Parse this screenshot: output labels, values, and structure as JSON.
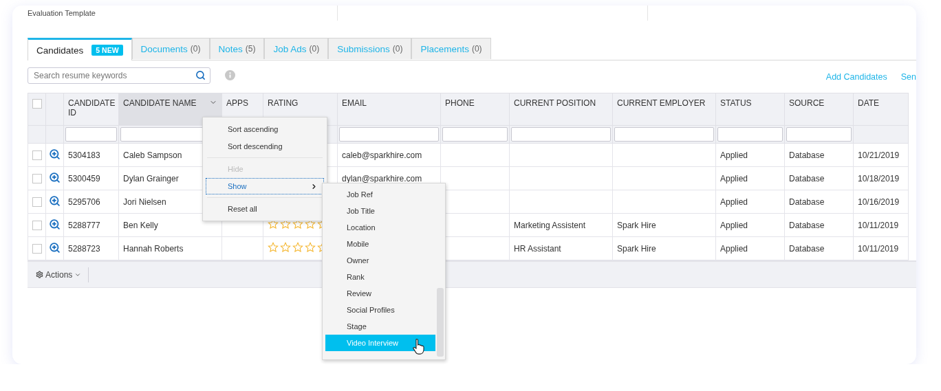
{
  "header_strip": {
    "label": "Evaluation Template"
  },
  "tabs": [
    {
      "label": "Candidates",
      "badge": "5 NEW",
      "selected": true
    },
    {
      "label": "Documents",
      "count": "(0)",
      "selected": false
    },
    {
      "label": "Notes",
      "count": "(5)",
      "selected": false
    },
    {
      "label": "Job Ads",
      "count": "(0)",
      "selected": false
    },
    {
      "label": "Submissions",
      "count": "(0)",
      "selected": false
    },
    {
      "label": "Placements",
      "count": "(0)",
      "selected": false
    }
  ],
  "toolbar": {
    "search": {
      "placeholder": "Search resume keywords"
    },
    "links": [
      "Add Candidates",
      "Sen"
    ]
  },
  "table": {
    "select_all": {
      "checked": false
    },
    "columns": [
      {
        "label": "CANDIDATE ID",
        "filter": true,
        "active": false
      },
      {
        "label": "CANDIDATE NAME",
        "filter": true,
        "active": true
      },
      {
        "label": "APPS",
        "active": false
      },
      {
        "label": "RATING",
        "filter": false,
        "active": false
      },
      {
        "label": "EMAIL",
        "filter": true,
        "active": false
      },
      {
        "label": "PHONE",
        "filter": true,
        "active": false
      },
      {
        "label": "CURRENT POSITION",
        "filter": true,
        "active": false
      },
      {
        "label": "CURRENT EMPLOYER",
        "filter": true,
        "active": false
      },
      {
        "label": "STATUS",
        "filter": true,
        "active": false
      },
      {
        "label": "SOURCE",
        "filter": true,
        "active": false
      },
      {
        "label": "DATE",
        "filter": false,
        "active": false
      }
    ],
    "rows": [
      {
        "checked": false,
        "id": "5304183",
        "name": "Caleb Sampson",
        "email": "caleb@sparkhire.com",
        "status": "Applied",
        "source": "Database",
        "date": "10/21/2019"
      },
      {
        "checked": false,
        "id": "5300459",
        "name": "Dylan Grainger",
        "email": "dylan@sparkhire.com",
        "status": "Applied",
        "source": "Database",
        "date": "10/18/2019"
      },
      {
        "checked": false,
        "id": "5295706",
        "name": "Jori Nielsen",
        "status": "Applied",
        "source": "Database",
        "date": "10/16/2019"
      },
      {
        "checked": false,
        "id": "5288777",
        "name": "Ben Kelly",
        "stars": 0,
        "position": "Marketing Assistent",
        "employer": "Spark Hire",
        "status": "Applied",
        "source": "Database",
        "date": "10/11/2019"
      },
      {
        "checked": false,
        "id": "5288723",
        "name": "Hannah Roberts",
        "stars": 0,
        "position": "HR Assistant",
        "employer": "Spark Hire",
        "status": "Applied",
        "source": "Database",
        "date": "10/11/2019"
      }
    ]
  },
  "footer": {
    "actions": "Actions"
  },
  "column_menu": {
    "items": [
      {
        "kind": "item",
        "label": "Sort ascending",
        "disabled": false
      },
      {
        "kind": "item",
        "label": "Sort descending",
        "disabled": false
      },
      {
        "kind": "divider"
      },
      {
        "kind": "item",
        "label": "Hide",
        "disabled": true
      },
      {
        "kind": "submenu",
        "label": "Show",
        "disabled": false,
        "focused": true
      },
      {
        "kind": "divider"
      },
      {
        "kind": "item",
        "label": "Reset all",
        "disabled": false
      }
    ]
  },
  "show_submenu": {
    "items": [
      {
        "label": "Job Ref",
        "selected": false
      },
      {
        "label": "Job Title",
        "selected": false
      },
      {
        "label": "Location",
        "selected": false
      },
      {
        "label": "Mobile",
        "selected": false
      },
      {
        "label": "Owner",
        "selected": false
      },
      {
        "label": "Rank",
        "selected": false
      },
      {
        "label": "Review",
        "selected": false
      },
      {
        "label": "Social Profiles",
        "selected": false
      },
      {
        "label": "Stage",
        "selected": false
      },
      {
        "label": "Video Interview",
        "selected": true
      }
    ]
  }
}
